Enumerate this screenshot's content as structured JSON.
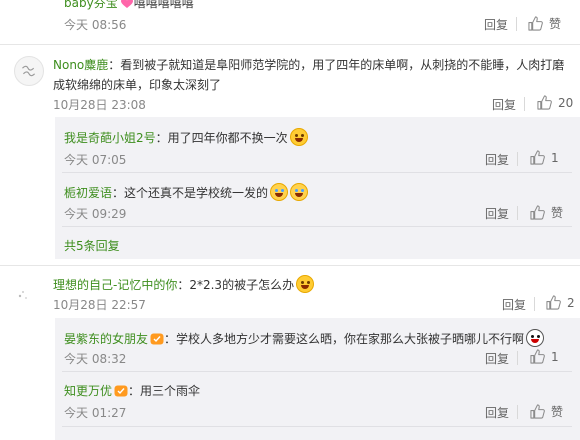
{
  "comments": [
    {
      "user": "baby芬宝",
      "text": "嘻嘻嘻嘻嘻",
      "time": "今天 08:56",
      "reply": "回复",
      "likes": "赞"
    },
    {
      "user": "Nono麋鹿",
      "text_line1": "：看到被子就知道是阜阳师范学院的，用了四年的床单啊，从刺挠的不能睡，人肉打磨",
      "text_line2": "成软绵绵的床单，印象太深刻了",
      "time": "10月28日 23:08",
      "reply": "回复",
      "likes": "20",
      "replies": [
        {
          "user": "我是奇葩小姐2号",
          "text": "：用了四年你都不换一次",
          "time": "今天 07:05",
          "reply": "回复",
          "likes": "1"
        },
        {
          "user": "栀初爱语",
          "text": "：这个还真不是学校统一发的",
          "time": "今天 09:29",
          "reply": "回复",
          "likes": "赞"
        }
      ],
      "more_replies": "共5条回复"
    },
    {
      "user": "理想的自己-记忆中的你",
      "text": "：2*2.3的被子怎么办",
      "time": "10月28日 22:57",
      "reply": "回复",
      "likes": "2",
      "replies": [
        {
          "user": "晏紫东的女朋友",
          "text": "：学校人多地方少才需要这么晒，你在家那么大张被子晒哪儿不行啊",
          "time": "今天 08:32",
          "reply": "回复",
          "likes": "1"
        },
        {
          "user": "知更万优",
          "text": "：用三个雨伞",
          "time": "今天 01:27",
          "reply": "回复",
          "likes": "赞"
        }
      ]
    }
  ],
  "colors": {
    "username": "#3e8e1e",
    "sub_bg": "#f2f2f5",
    "time": "#888888"
  },
  "icons": [
    "thumbs-up-icon",
    "avatar-placeholder-icon",
    "laughing-emoji",
    "crying-laugh-emoji",
    "shy-emoji",
    "vip-badge-icon",
    "heart-badge-icon"
  ]
}
